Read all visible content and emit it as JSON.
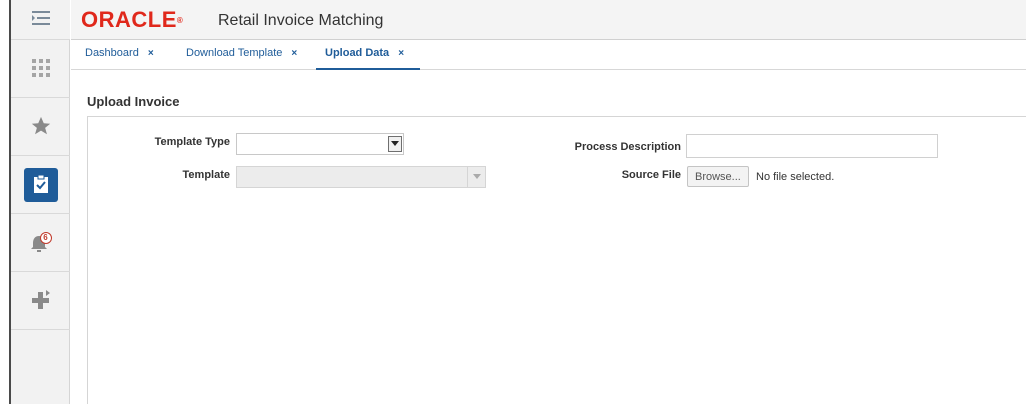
{
  "header": {
    "logo_text": "ORACLE",
    "logo_mark": "®",
    "app_title": "Retail Invoice Matching"
  },
  "sidebar": {
    "items": [
      {
        "name": "menu",
        "icon": "menu-icon"
      },
      {
        "name": "apps",
        "icon": "grid-icon"
      },
      {
        "name": "favorites",
        "icon": "star-icon"
      },
      {
        "name": "tasks",
        "icon": "clipboard-check-icon",
        "active": true
      },
      {
        "name": "notifications",
        "icon": "bell-icon",
        "badge": "6"
      },
      {
        "name": "create",
        "icon": "plus-icon"
      }
    ],
    "accent_color": "#1f5c99"
  },
  "tabs": [
    {
      "label": "Dashboard",
      "close": "×"
    },
    {
      "label": "Download Template",
      "close": "×"
    },
    {
      "label": "Upload Data",
      "close": "×",
      "active": true
    }
  ],
  "page": {
    "title": "Upload Invoice"
  },
  "form": {
    "template_type_label": "Template Type",
    "template_type_value": "",
    "template_label": "Template",
    "template_value": "",
    "process_description_label": "Process Description",
    "process_description_value": "",
    "source_file_label": "Source File",
    "browse_label": "Browse...",
    "file_status": "No file selected."
  }
}
